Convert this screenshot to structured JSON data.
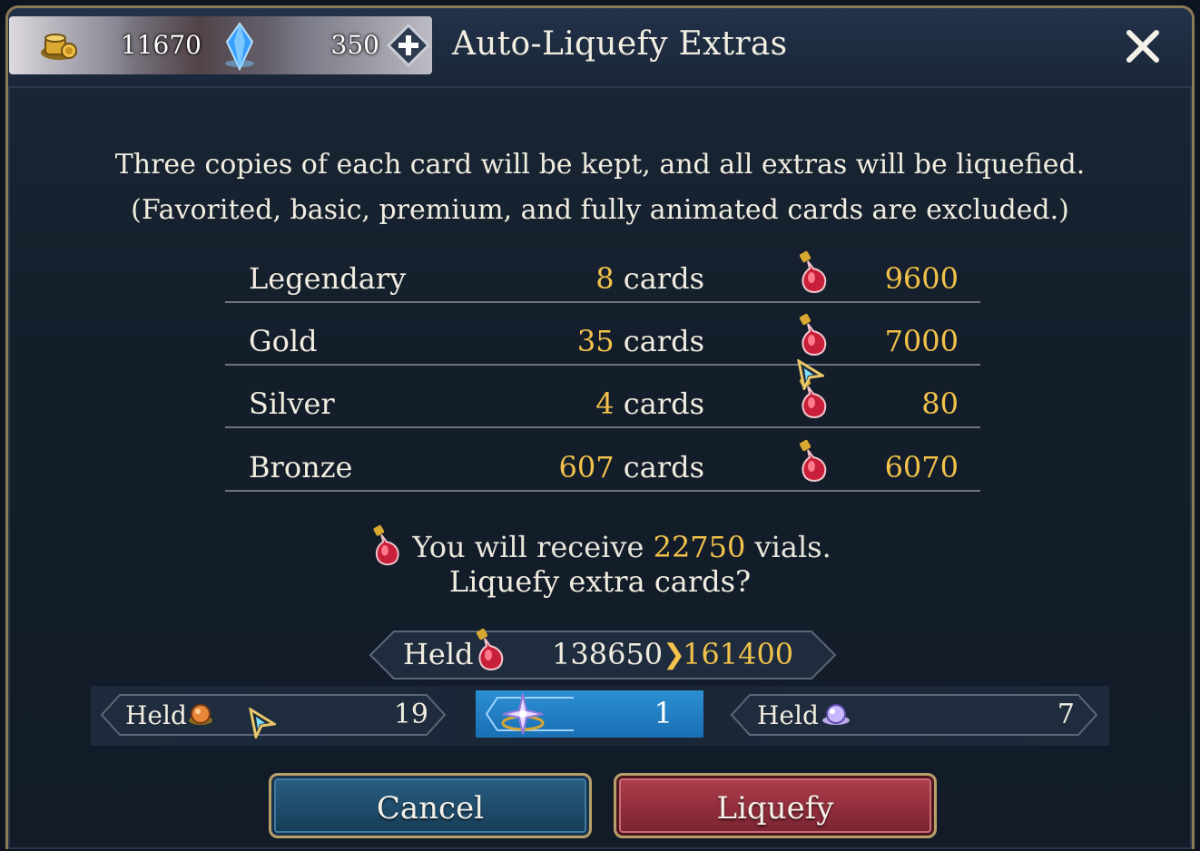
{
  "header": {
    "gold_amount": "11670",
    "crystal_amount": "350",
    "title": "Auto-Liquefy Extras"
  },
  "description": {
    "line1": "Three copies of each card will be kept, and all extras will be liquefied.",
    "line2": "(Favorited, basic, premium, and fully animated cards are excluded.)"
  },
  "rows": [
    {
      "label": "Legendary",
      "count": "8",
      "unit": "cards",
      "vials": "9600"
    },
    {
      "label": "Gold",
      "count": "35",
      "unit": "cards",
      "vials": "7000"
    },
    {
      "label": "Silver",
      "count": "4",
      "unit": "cards",
      "vials": "80"
    },
    {
      "label": "Bronze",
      "count": "607",
      "unit": "cards",
      "vials": "6070"
    }
  ],
  "summary": {
    "receive_prefix": "You will receive",
    "receive_amount": "22750",
    "receive_suffix": "vials.",
    "confirm": "Liquefy extra cards?"
  },
  "held_vials": {
    "label": "Held",
    "current": "138650",
    "after": "161400"
  },
  "held_items": {
    "orb_label": "Held",
    "orb_count": "19",
    "star_count": "1",
    "crystal_label": "Held",
    "crystal_count": "7"
  },
  "buttons": {
    "cancel": "Cancel",
    "liquefy": "Liquefy"
  },
  "colors": {
    "highlight": "#f2c24b",
    "cancel_button": "#1e4a69",
    "liquefy_button": "#8e2c3a",
    "selected_slot": "#1a6fb3"
  },
  "icons": {
    "gold": "gold-coins-icon",
    "crystal": "blue-crystal-icon",
    "vial": "red-vial-icon",
    "orb": "orange-orb-icon",
    "star": "star-emblem-icon",
    "small_crystal": "purple-crystal-icon",
    "close": "close-icon",
    "plus": "plus-icon"
  }
}
